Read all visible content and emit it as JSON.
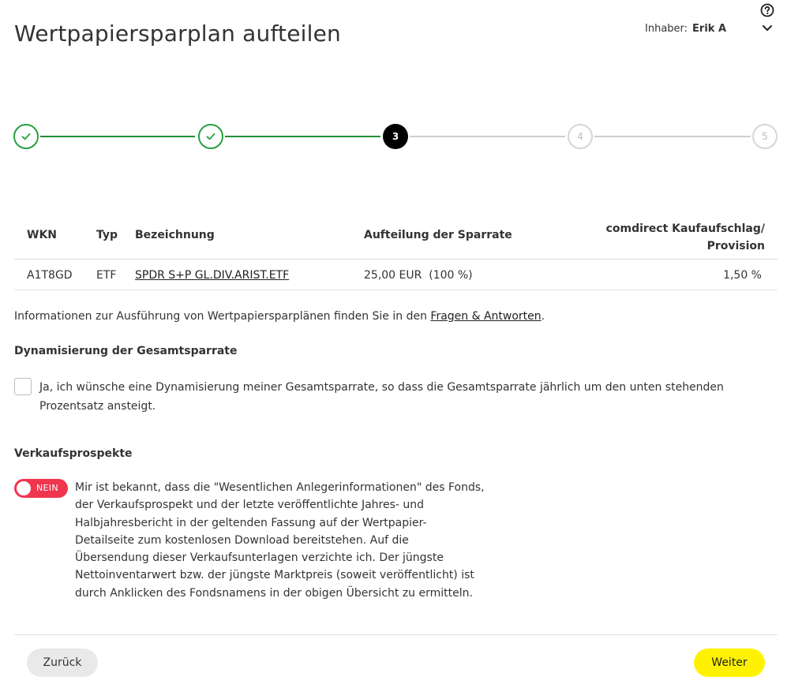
{
  "header": {
    "title": "Wertpapiersparplan aufteilen",
    "owner_label": "Inhaber:",
    "owner_name": "Erik A",
    "help_icon": "question-circle-icon",
    "chevron_icon": "chevron-down-icon"
  },
  "stepper": {
    "steps": [
      {
        "label": "",
        "state": "done"
      },
      {
        "label": "",
        "state": "done"
      },
      {
        "label": "3",
        "state": "active"
      },
      {
        "label": "4",
        "state": "todo"
      },
      {
        "label": "5",
        "state": "todo"
      }
    ],
    "colors": {
      "done": "#27a040",
      "active": "#000000",
      "todo": "#d6d6d6"
    }
  },
  "table": {
    "headers": {
      "wkn": "WKN",
      "typ": "Typ",
      "bezeichnung": "Bezeichnung",
      "aufteilung": "Aufteilung der Sparrate",
      "aufschlag_line1": "comdirect Kaufaufschlag/",
      "aufschlag_line2": "Provision"
    },
    "rows": [
      {
        "wkn": "A1T8GD",
        "typ": "ETF",
        "bezeichnung": "SPDR S+P GL.DIV.ARIST.ETF",
        "aufteilung": "25,00 EUR  (100 %)",
        "aufschlag": "1,50 %"
      }
    ]
  },
  "info": {
    "text": "Informationen zur Ausführung von Wertpapiersparplänen finden Sie in den ",
    "link": "Fragen & Antworten",
    "end": "."
  },
  "dynamisierung": {
    "title": "Dynamisierung der Gesamtsparrate",
    "checkbox_label": "Ja, ich wünsche eine Dynamisierung meiner Gesamtsparrate, so dass die Gesamtsparrate jährlich um den unten stehenden Prozentsatz ansteigt.",
    "checked": false
  },
  "verkaufsprospekte": {
    "title": "Verkaufsprospekte",
    "toggle_label": "NEIN",
    "toggle_color": "#f0354f",
    "text": "Mir ist bekannt, dass die \"Wesentlichen Anlegerinformationen\" des Fonds, der Verkaufsprospekt und der letzte veröffentlichte Jahres- und Halbjahresbericht in der geltenden Fassung auf der Wertpapier-Detailseite zum kostenlosen Download bereitstehen. Auf die Übersendung dieser Verkaufsunterlagen verzichte ich. Der jüngste Nettoinventarwert bzw. der jüngste Marktpreis (soweit veröffentlicht) ist durch Anklicken des Fondsnamens in der obigen Übersicht zu ermitteln."
  },
  "footer": {
    "back_label": "Zurück",
    "next_label": "Weiter",
    "next_color": "#fff200"
  }
}
